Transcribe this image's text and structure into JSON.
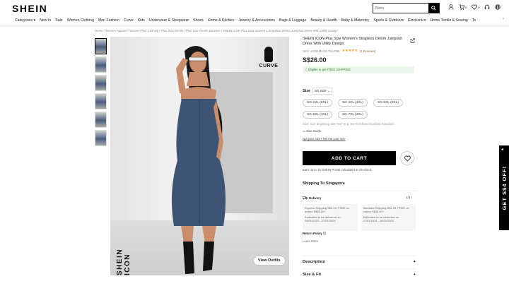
{
  "header": {
    "logo": "SHEIN",
    "search_placeholder": "Bikini",
    "icons": [
      "search-icon",
      "user-icon",
      "cart-icon",
      "heart-icon",
      "headset-icon",
      "globe-icon"
    ],
    "cart_count": "0",
    "wish_count": "0"
  },
  "nav": {
    "items": [
      "Categories ▾",
      "New In",
      "Sale",
      "Women Clothing",
      "Men Fashion",
      "Curve",
      "Kids",
      "Underwear & Sleepwear",
      "Shoes",
      "Home & Kitchen",
      "Jewelry & Accessories",
      "Bags & Luggage",
      "Beauty & Health",
      "Baby & Maternity",
      "Sports & Outdoors",
      "Electronics",
      "Home Textile & Sewing",
      "To"
    ]
  },
  "breadcrumb": "Home / Women Apparel / Women Plus Clothing / Plus Size Denim / Plus Size Denim Dresses / SHEIN ICON Plus Size Women's Strapless Denim Jumpsuit Dress With Utility Design",
  "gallery": {
    "brand_watermark": "SHEIN ICON",
    "curve_badge": "CURVE",
    "view_outfits": "View Outfits"
  },
  "product": {
    "title": "SHEIN ICON Plus Size Women's Strapless Denim Jumpsuit Dress With Utility Design",
    "sku": "SKU: sz2311110117514086",
    "stars": "★★★★★",
    "reviews": "(4 Reviews)",
    "price": "S$26.00",
    "shipping_banner": "✓ Eligible to get FREE SHIPPING"
  },
  "size": {
    "label": "Size",
    "selector": "SG Size ⌄",
    "options": [
      "SG-1XL (0XL)",
      "SG-4XL (1XL)",
      "SG-5XL (2XL)",
      "SG-6XL (3XL)",
      "SG-7XL (4XL)"
    ],
    "note": "Size: Size beginning with \"SG\" (e.g. SG-S) follows localized Standard",
    "guide": "Size Guide",
    "fit": "Not your size? Tell me your size"
  },
  "cart": {
    "add_label": "ADD TO CART",
    "points": "Earn up to 18 SHEIN Points calculated at checkout."
  },
  "shipping": {
    "title": "Shipping To Singapore",
    "delivery_label": "Delivery",
    "pager": "1/3 ›",
    "cards": [
      {
        "title": "Express Shipping S$3.99, FREE on orders S$89.00+",
        "eta": "Estimated to be delivered on 25/01/2024 - 27/01/2024"
      },
      {
        "title": "Standard Shipping S$1.99, FREE on orders S$49.00+",
        "eta": "Estimated to be delivered on 27/01/2024 - 28/01/2024"
      }
    ],
    "return_label": "Return Policy",
    "learn_more": "Learn More"
  },
  "accordions": [
    "Description",
    "Size & Fit"
  ],
  "promo": "GET S$4 OFF!",
  "colors": {
    "accent": "#000000",
    "stars": "#f5a623",
    "free_ship_bg": "#ecf7ec",
    "denim": "#3d5474"
  }
}
